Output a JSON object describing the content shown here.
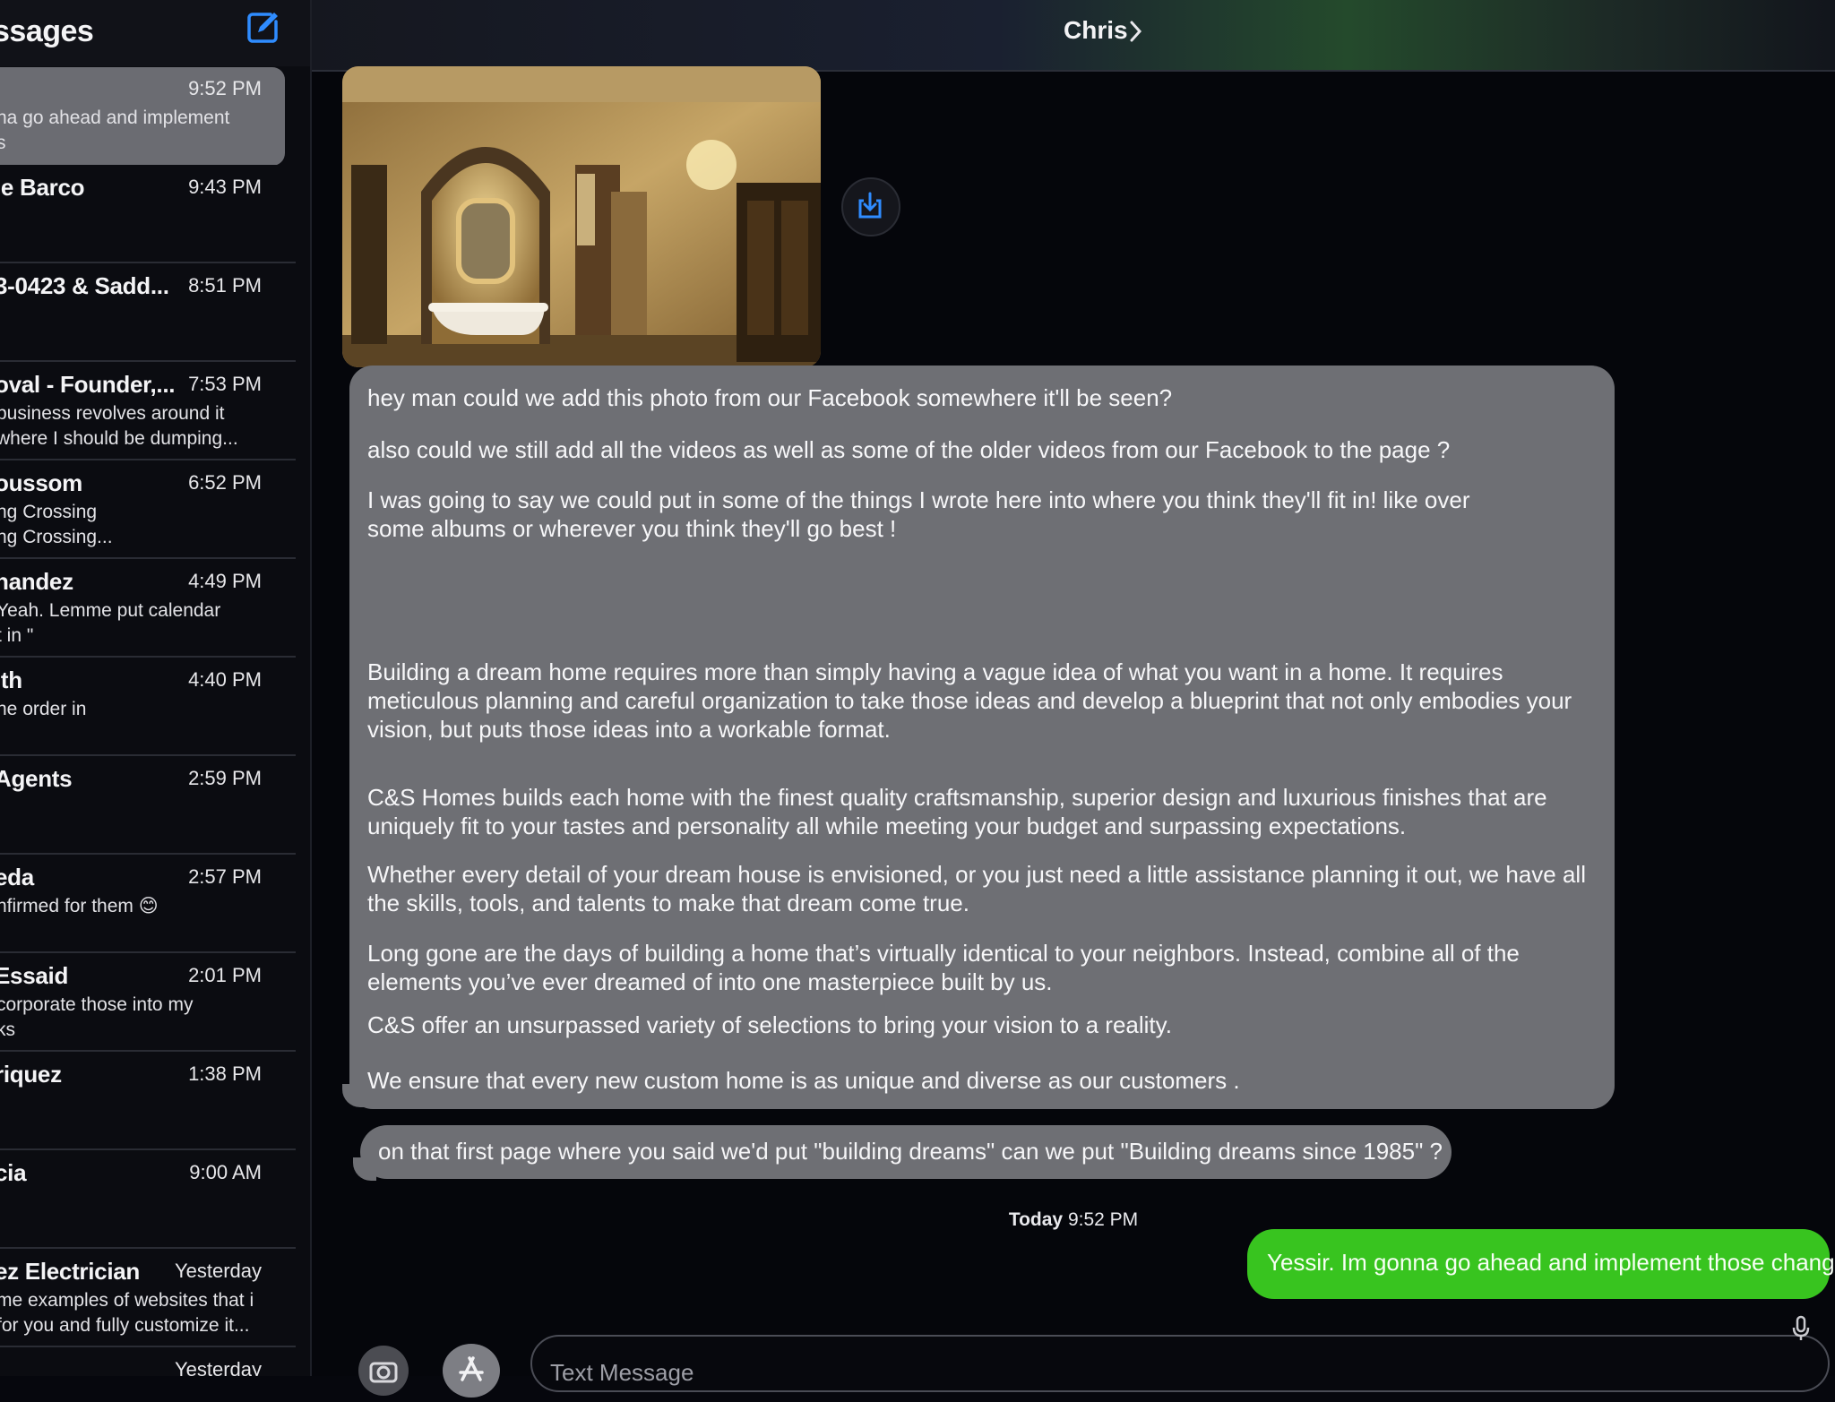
{
  "sidebar": {
    "title": "ssages",
    "compose_icon": "compose-icon",
    "conversations": [
      {
        "name": "",
        "time": "9:52 PM",
        "preview": "na go ahead and implement\ns",
        "selected": true
      },
      {
        "name": "le Barco",
        "time": "9:43 PM",
        "preview": ""
      },
      {
        "name": "3-0423 & Sadd...",
        "time": "8:51 PM",
        "preview": ""
      },
      {
        "name": "oval - Founder,...",
        "time": "7:53 PM",
        "preview": "business revolves around it\nwhere I should be dumping..."
      },
      {
        "name": "oussom",
        "time": "6:52 PM",
        "preview": "ng Crossing\nng Crossing..."
      },
      {
        "name": "nandez",
        "time": "4:49 PM",
        "preview": "Yeah. Lemme put calendar\nt in \""
      },
      {
        "name": "ith",
        "time": "4:40 PM",
        "preview": "ne order in"
      },
      {
        "name": "Agents",
        "time": "2:59 PM",
        "preview": ""
      },
      {
        "name": "eda",
        "time": "2:57 PM",
        "preview": "nfirmed for them 😊"
      },
      {
        "name": "Essaid",
        "time": "2:01 PM",
        "preview": "corporate those into my\nks"
      },
      {
        "name": "riquez",
        "time": "1:38 PM",
        "preview": ""
      },
      {
        "name": "cia",
        "time": "9:00 AM",
        "preview": ""
      },
      {
        "name": "ez Electrician",
        "time": "Yesterday",
        "preview": "me examples of websites that i\nfor you and fully customize it..."
      },
      {
        "name": "",
        "time": "Yesterday",
        "preview": ""
      }
    ]
  },
  "header": {
    "contact_name": "Chris",
    "chevron_icon": "chevron-right-icon"
  },
  "messages": {
    "photo_alt": "bathroom-photo",
    "save_icon": "save-to-photos-icon",
    "main_paragraphs": [
      "hey man could we add this photo from our Facebook somewhere it'll be seen?",
      "also could we still add all the videos as well as some of the older videos from our Facebook to the page ?",
      "I was going to say we could put in some of the things I wrote here into where you think they'll fit in! like over some albums or wherever you think they'll go best !",
      "Building a dream home requires more than simply having a vague idea of what you want in a home. It requires meticulous planning and careful organization to take those ideas and develop a blueprint that not only embodies your vision, but puts those ideas into a workable format.",
      "C&S Homes builds each home with the finest quality craftsmanship, superior design and luxurious finishes that are uniquely fit to your tastes and personality all while meeting your budget and surpassing expectations.",
      " Whether every detail of your dream house is envisioned, or you just need a little assistance planning it out, we have all the skills, tools, and talents to make that dream come true.",
      "Long gone are the days of building a home that’s virtually identical to your neighbors. Instead, combine all of the elements you’ve ever dreamed of into one masterpiece built by us.",
      "C&S offer an unsurpassed variety of selections to bring your vision to a reality.",
      "We ensure that every new custom home is as unique and diverse as our customers ."
    ],
    "second_incoming": "on that first page where you said we'd put \"building dreams\" can we put \"Building dreams since 1985\" ?",
    "timestamp_day": "Today",
    "timestamp_time": "9:52 PM",
    "outgoing": "Yessir. Im gonna go ahead and implement those changes"
  },
  "composer": {
    "placeholder": "Text Message",
    "camera_icon": "camera-icon",
    "apps_icon": "app-store-icon",
    "mic_icon": "microphone-icon"
  },
  "colors": {
    "incoming_bubble": "#6e6f74",
    "outgoing_bubble": "#38c41f",
    "accent": "#2f8cff"
  }
}
